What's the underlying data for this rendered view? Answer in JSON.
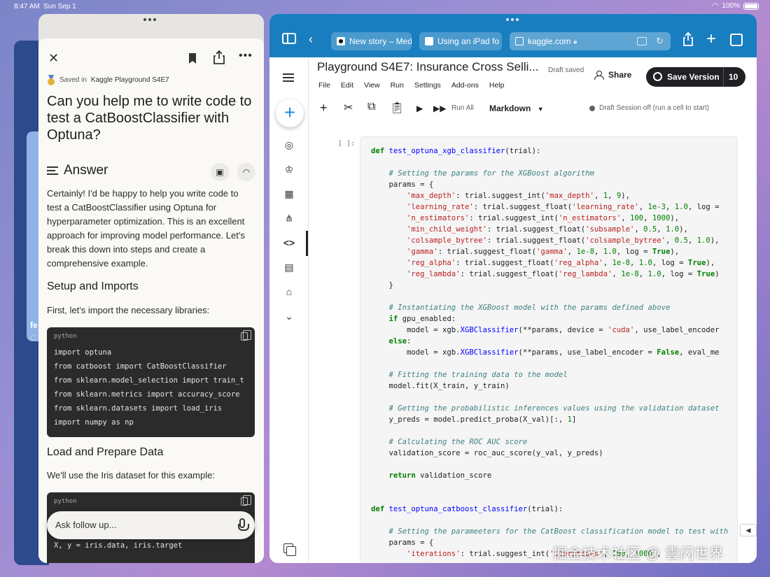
{
  "status": {
    "time": "8:47 AM",
    "date": "Sun Sep 1",
    "battery": "100%"
  },
  "bg_app": {
    "title_peek": "fe",
    "sub_peek": "C"
  },
  "chat": {
    "saved_prefix": "Saved in",
    "project": "Kaggle Playground S4E7",
    "question": "Can you help me to write code to test a CatBoostClassifier with Optuna?",
    "answer_heading": "Answer",
    "intro": "Certainly! I'd be happy to help you write code to test a CatBoostClassifier using Optuna for hyperparameter optimization. This is an excellent approach for improving model performance. Let's break this down into steps and create a comprehensive example.",
    "section1": "Setup and Imports",
    "section1_text": "First, let's import the necessary libraries:",
    "code1_lang": "python",
    "code1_lines": [
      "import optuna",
      "from catboost import CatBoostClassifier",
      "from sklearn.model_selection import train_t",
      "from sklearn.metrics import accuracy_score",
      "from sklearn.datasets import load_iris",
      "import numpy as np"
    ],
    "section2": "Load and Prepare Data",
    "section2_text": "We'll use the Iris dataset for this example:",
    "code2_lang": "python",
    "code2_last": "X, y = iris.data, iris.target",
    "followup_placeholder": "Ask follow up..."
  },
  "browser": {
    "tabs": [
      "New story – Medium",
      "Using an iPad fo"
    ],
    "url": "kaggle.com"
  },
  "kaggle": {
    "title": "Playground S4E7: Insurance Cross Selli...",
    "draft_status": "Draft saved",
    "share_label": "Share",
    "save_version_label": "Save Version",
    "version_count": "10",
    "menu": [
      "File",
      "Edit",
      "View",
      "Run",
      "Settings",
      "Add-ons",
      "Help"
    ],
    "run_all": "Run All",
    "cell_type": "Markdown",
    "session": "Draft Session off (run a cell to start)",
    "cell_prompt": "[ ]:"
  },
  "watermark": "掘金技术社区 @ 雲闪世界",
  "icons": {
    "close": "close-icon",
    "bookmark": "bookmark-icon",
    "share": "share-icon",
    "more": "more-icon",
    "mic": "mic-icon",
    "copy": "copy-icon"
  }
}
